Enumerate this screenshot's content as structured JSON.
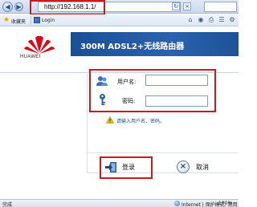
{
  "browser": {
    "url": "http://192.168.1.1/",
    "favorites_label": "收藏夹",
    "tab_title": "Login"
  },
  "brand": {
    "logo_text": "HUAWEI",
    "product_title": "300M ADSL2+无线路由器",
    "logo_color": "#e60012",
    "banner_color": "#1a4f96"
  },
  "login_form": {
    "username_label": "用户名:",
    "username_value": "",
    "password_label": "密码:",
    "password_value": "",
    "hint": "请输入用户名、密码。",
    "login_button": "登录",
    "cancel_button": "取消"
  },
  "status_bar": {
    "left_text": "完成",
    "zone": "Internet | 保护模式: 禁用",
    "zoom": "100%"
  },
  "highlight_color": "#d01a1a"
}
